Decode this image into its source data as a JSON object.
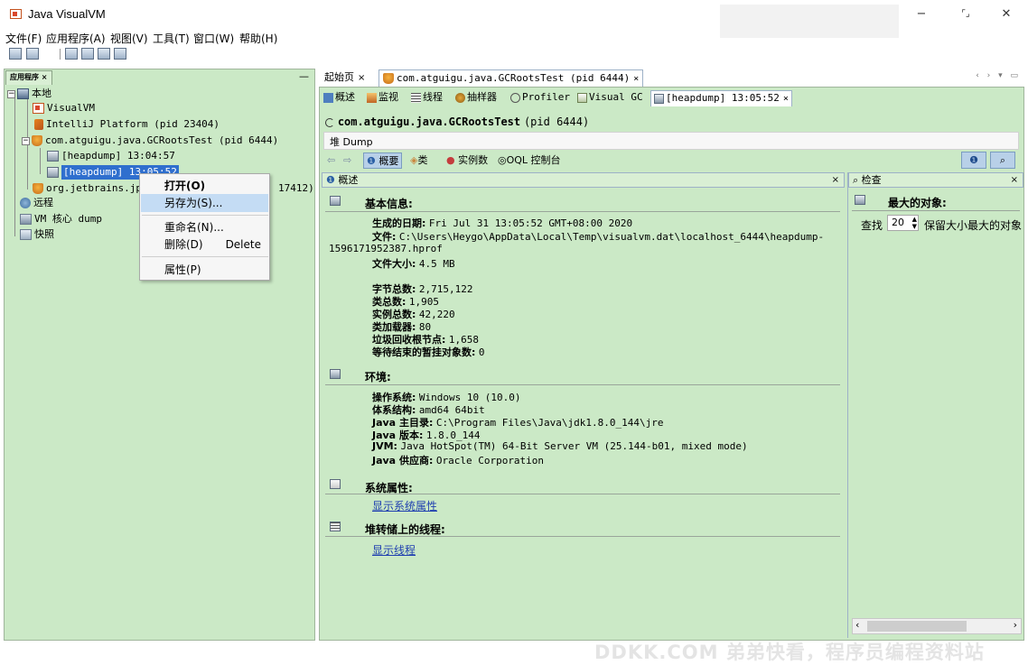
{
  "window": {
    "title": "Java VisualVM",
    "controls": {
      "minimize": "−",
      "maximize": "⌜⌟",
      "close": "✕"
    }
  },
  "menu": [
    "文件(F)",
    "应用程序(A)",
    "视图(V)",
    "工具(T)",
    "窗口(W)",
    "帮助(H)"
  ],
  "left_panel": {
    "tab_label": "应用程序 ×",
    "minimize": "—",
    "tree": {
      "local": "本地",
      "visualvm": "VisualVM",
      "intellij": "IntelliJ Platform (pid 23404)",
      "gcroots": "com.atguigu.java.GCRootsTest (pid 6444)",
      "heap1": "[heapdump] 13:04:57",
      "heap2": "[heapdump] 13:05:52",
      "jetbrains": "org.jetbrains.jp",
      "jetbrains_tail": "17412)",
      "remote": "远程",
      "core": "VM 核心 dump",
      "snapshot": "快照"
    }
  },
  "context_menu": {
    "open": "打开(O)",
    "save_as": "另存为(S)...",
    "rename": "重命名(N)...",
    "delete": "删除(D)",
    "delete_key": "Delete",
    "properties": "属性(P)"
  },
  "editor": {
    "start_tab": "起始页",
    "start_close": "×",
    "app_tab": "com.atguigu.java.GCRootsTest (pid 6444)",
    "app_close": "×",
    "controls": "‹ › ▾ ▭"
  },
  "subtabs": {
    "overview": "概述",
    "monitor": "监视",
    "threads": "线程",
    "sampler": "抽样器",
    "profiler": "Profiler",
    "visualgc": "Visual GC",
    "heapdump": "[heapdump] 13:05:52",
    "heapdump_close": "×"
  },
  "header": {
    "app_name": "com.atguigu.java.GCRootsTest",
    "pid": "(pid 6444)",
    "heap_label": "堆 Dump"
  },
  "nav": {
    "back": "⇦",
    "forward": "⇨",
    "summary": "概要",
    "classes": "类",
    "instances": "实例数",
    "oql": "OQL 控制台",
    "info_btn": "❶",
    "search_btn": "⌕"
  },
  "overview_pane": {
    "title": "概述",
    "close": "×",
    "basic_info": {
      "title": "基本信息:",
      "date_label": "生成的日期:",
      "date_value": "Fri Jul 31 13:05:52 GMT+08:00 2020",
      "file_label": "文件:",
      "file_value": "C:\\Users\\Heygo\\AppData\\Local\\Temp\\visualvm.dat\\localhost_6444\\heapdump-",
      "file_value_cont": "1596171952387.hprof",
      "size_label": "文件大小:",
      "size_value": "4.5 MB",
      "bytes_label": "字节总数:",
      "bytes_value": "2,715,122",
      "classes_label": "类总数:",
      "classes_value": "1,905",
      "instances_label": "实例总数:",
      "instances_value": "42,220",
      "loaders_label": "类加载器:",
      "loaders_value": "80",
      "gcroots_label": "垃圾回收根节点:",
      "gcroots_value": "1,658",
      "pending_label": "等待结束的暂挂对象数:",
      "pending_value": "0"
    },
    "environment": {
      "title": "环境:",
      "os_label": "操作系统:",
      "os_value": "Windows 10 (10.0)",
      "arch_label": "体系结构:",
      "arch_value": "amd64 64bit",
      "home_label": "Java 主目录:",
      "home_value": "C:\\Program Files\\Java\\jdk1.8.0_144\\jre",
      "version_label": "Java 版本:",
      "version_value": "1.8.0_144",
      "jvm_label": "JVM:",
      "jvm_value": "Java HotSpot(TM) 64-Bit Server VM (25.144-b01, mixed mode)",
      "vendor_label": "Java 供应商:",
      "vendor_value": "Oracle Corporation"
    },
    "sysprops": {
      "title": "系统属性:",
      "link": "显示系统属性"
    },
    "threads": {
      "title": "堆转储上的线程:",
      "link": "显示线程"
    }
  },
  "inspect_pane": {
    "title": "检查",
    "close": "×",
    "largest": "最大的对象:",
    "find": "查找",
    "count": "20",
    "retain": "保留大小最大的对象"
  },
  "watermark": "DDKK.COM 弟弟快看，程序员编程资料站"
}
